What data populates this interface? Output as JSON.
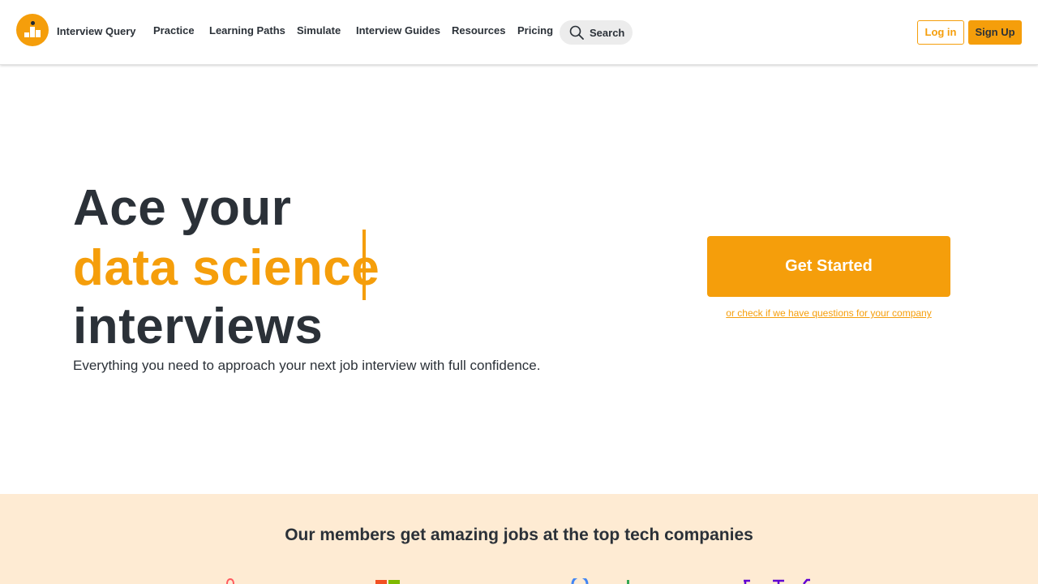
{
  "brand": {
    "name": "Interview Query"
  },
  "nav": {
    "items": [
      "Practice",
      "Learning Paths",
      "Simulate",
      "Interview Guides",
      "Resources",
      "Pricing"
    ],
    "search_label": "Search"
  },
  "auth": {
    "login_label": "Log in",
    "signup_label": "Sign Up"
  },
  "hero": {
    "line1": "Ace your",
    "line2": "data science",
    "line3": "interviews",
    "subtitle": "Everything you need to approach your next job interview with full confidence.",
    "cta_label": "Get Started",
    "check_link": "or check if we have questions for your company"
  },
  "companies": {
    "title": "Our members get amazing jobs at the top tech companies",
    "logos": [
      "airbnb-icon",
      "microsoft-icon",
      "google-icon",
      "yahoo-icon"
    ]
  },
  "colors": {
    "accent": "#f59e0b",
    "text": "#2b3138",
    "band": "#feebd3"
  }
}
